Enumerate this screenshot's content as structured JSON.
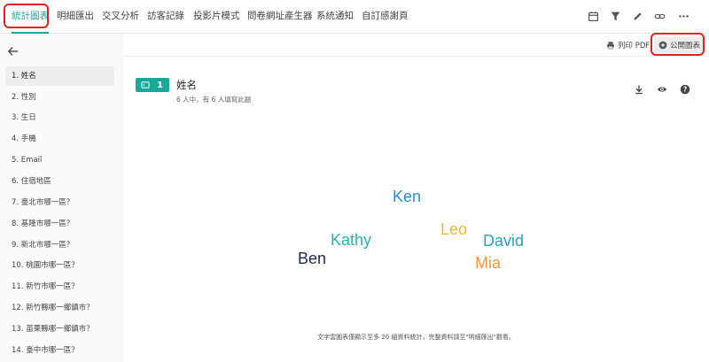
{
  "colors": {
    "accent": "#1aa89a",
    "highlight": "#e0241f"
  },
  "nav": {
    "tabs": [
      {
        "label": "統計圖表",
        "active": true
      },
      {
        "label": "明細匯出"
      },
      {
        "label": "交叉分析"
      },
      {
        "label": "訪客記錄"
      },
      {
        "label": "投影片模式"
      },
      {
        "label": "問卷網址產生器"
      },
      {
        "label": "系統通知"
      },
      {
        "label": "自訂感謝頁"
      }
    ],
    "icons": [
      "calendar-icon",
      "filter-icon",
      "pencil-icon",
      "link-icon",
      "more-icon"
    ]
  },
  "toolbar": {
    "print_label": "列印 PDF",
    "public_label": "公開圖表"
  },
  "sidebar": {
    "items": [
      {
        "label": "1. 姓名",
        "active": true
      },
      {
        "label": "2. 性別"
      },
      {
        "label": "3. 生日"
      },
      {
        "label": "4. 手機"
      },
      {
        "label": "5. Email"
      },
      {
        "label": "6. 住宿地區"
      },
      {
        "label": "7. 臺北市哪一區？"
      },
      {
        "label": "8. 基隆市哪一區？"
      },
      {
        "label": "9. 新北市哪一區？"
      },
      {
        "label": "10. 桃園市哪一區？"
      },
      {
        "label": "11. 新竹市哪一區？"
      },
      {
        "label": "12. 新竹縣哪一鄉鎮市？"
      },
      {
        "label": "13. 苗栗縣哪一鄉鎮市？"
      },
      {
        "label": "14. 臺中市哪一區？"
      }
    ]
  },
  "question": {
    "number": "1",
    "title": "姓名",
    "subtitle": "6 人中，有 6 人填寫此題",
    "actions": [
      "download-icon",
      "eye-icon",
      "help-icon"
    ]
  },
  "wordcloud": {
    "words": [
      {
        "text": "Ken",
        "color": "#2b8fd8"
      },
      {
        "text": "Leo",
        "color": "#f2b632"
      },
      {
        "text": "Kathy",
        "color": "#25b8a8"
      },
      {
        "text": "David",
        "color": "#2aa0c8"
      },
      {
        "text": "Ben",
        "color": "#1e2a55"
      },
      {
        "text": "Mia",
        "color": "#f29a4a"
      }
    ]
  },
  "footnote": "文字雲圖表僅顯示至多 20 組資料統計，完整資料請至\"明細匯出\"觀看。"
}
